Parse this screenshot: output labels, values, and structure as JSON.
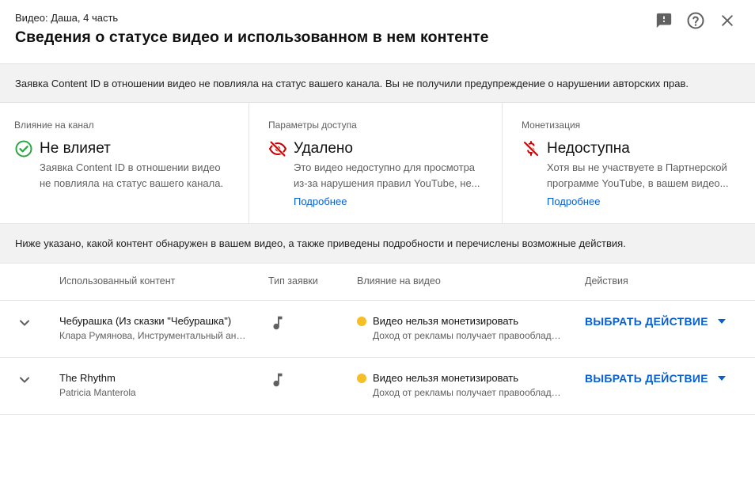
{
  "header": {
    "subtitle": "Видео: Даша, 4 часть",
    "title": "Сведения о статусе видео и использованном в нем контенте",
    "icons": [
      "feedback-icon",
      "help-icon",
      "close-icon"
    ]
  },
  "banner": {
    "text": "Заявка Content ID в отношении видео не повлияла на статус вашего канала. Вы не получили предупреждение о нарушении авторских прав."
  },
  "cards": [
    {
      "label": "Влияние на канал",
      "status": "Не влияет",
      "icon": "check-circle-icon",
      "icon_color": "#2ba640",
      "desc_line1": "Заявка Content ID в отношении видео",
      "desc_line2": "не повлияла на статус вашего канала."
    },
    {
      "label": "Параметры доступа",
      "status": "Удалено",
      "icon": "visibility-off-icon",
      "icon_color": "#cc0000",
      "desc_line1": "Это видео недоступно для просмотра",
      "desc_line2": "из-за нарушения правил YouTube, не...",
      "link": "Подробнее"
    },
    {
      "label": "Монетизация",
      "status": "Недоступна",
      "icon": "money-off-icon",
      "icon_color": "#cc0000",
      "desc_line1": "Хотя вы не участвуете в Партнерской",
      "desc_line2": "программе YouTube, в вашем видео...",
      "link": "Подробнее"
    }
  ],
  "info": {
    "text": "Ниже указано, какой контент обнаружен в вашем видео, а также приведены подробности и перечислены возможные действия."
  },
  "table": {
    "columns": [
      "Использованный контент",
      "Тип заявки",
      "Влияние на видео",
      "Действия"
    ],
    "rows": [
      {
        "title": "Чебурашка (Из сказки \"Чебурашка\")",
        "subtitle": "Клара Румянова, Инструментальный ансамбль",
        "claim_type_icon": "music-note-icon",
        "impact": "Видео нельзя монетизировать",
        "impact_detail": "Доход от рекламы получает правообладатель",
        "action": "ВЫБРАТЬ ДЕЙСТВИЕ"
      },
      {
        "title": "The Rhythm",
        "subtitle": "Patricia Manterola",
        "claim_type_icon": "music-note-icon",
        "impact": "Видео нельзя монетизировать",
        "impact_detail": "Доход от рекламы получает правообладатель",
        "action": "ВЫБРАТЬ ДЕЙСТВИЕ"
      }
    ]
  },
  "colors": {
    "accent": "#065fd4",
    "success": "#2ba640",
    "danger": "#cc0000",
    "warning": "#f6bf26"
  }
}
